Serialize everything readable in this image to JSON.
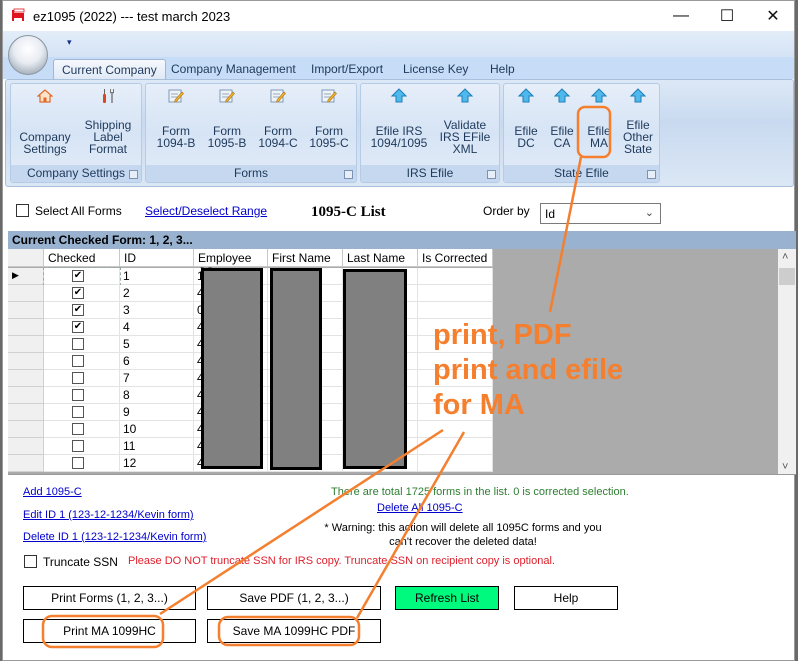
{
  "window": {
    "title": "ez1095 (2022) --- test march 2023",
    "minimize_glyph": "—",
    "maximize_glyph": "☐",
    "close_glyph": "✕"
  },
  "ribbon": {
    "qat_glyph": "▾",
    "tabs": [
      {
        "label": "Current Company",
        "active": true
      },
      {
        "label": "Company Management",
        "active": false
      },
      {
        "label": "Import/Export",
        "active": false
      },
      {
        "label": "License Key",
        "active": false
      },
      {
        "label": "Help",
        "active": false
      }
    ],
    "groups": [
      {
        "label": "Company Settings",
        "buttons": [
          {
            "label": "Company Settings",
            "icon": "home-icon"
          },
          {
            "label": "Shipping Label Format",
            "icon": "tools-icon"
          }
        ]
      },
      {
        "label": "Forms",
        "buttons": [
          {
            "label": "Form 1094-B",
            "icon": "form-edit-icon"
          },
          {
            "label": "Form 1095-B",
            "icon": "form-edit-icon"
          },
          {
            "label": "Form 1094-C",
            "icon": "form-edit-icon"
          },
          {
            "label": "Form 1095-C",
            "icon": "form-edit-icon"
          }
        ]
      },
      {
        "label": "IRS Efile",
        "buttons": [
          {
            "label": "Efile IRS 1094/1095",
            "icon": "upload-arrow-icon"
          },
          {
            "label": "Validate IRS EFile XML",
            "icon": "upload-arrow-icon"
          }
        ]
      },
      {
        "label": "State Efile",
        "buttons": [
          {
            "label": "Efile DC",
            "icon": "upload-arrow-icon"
          },
          {
            "label": "Efile CA",
            "icon": "upload-arrow-icon"
          },
          {
            "label": "Efile MA",
            "icon": "upload-arrow-icon"
          },
          {
            "label": "Efile Other State",
            "icon": "upload-arrow-icon"
          }
        ]
      }
    ]
  },
  "list_toolbar": {
    "select_all_label": "Select All Forms",
    "select_range_link": "Select/Deselect Range",
    "list_title": "1095-C List",
    "order_by_label": "Order by",
    "order_by_value": "Id"
  },
  "grid": {
    "checked_banner": "Current Checked Form: 1, 2, 3...",
    "columns": [
      "Checked",
      "ID",
      "Employee SS",
      "First Name",
      "Last Name",
      "Is Corrected"
    ],
    "rows": [
      {
        "checked": true,
        "id": "1",
        "ssn_first": "1"
      },
      {
        "checked": true,
        "id": "2",
        "ssn_first": "4"
      },
      {
        "checked": true,
        "id": "3",
        "ssn_first": "0"
      },
      {
        "checked": true,
        "id": "4",
        "ssn_first": "4"
      },
      {
        "checked": false,
        "id": "5",
        "ssn_first": "4"
      },
      {
        "checked": false,
        "id": "6",
        "ssn_first": "4"
      },
      {
        "checked": false,
        "id": "7",
        "ssn_first": "4"
      },
      {
        "checked": false,
        "id": "8",
        "ssn_first": "4"
      },
      {
        "checked": false,
        "id": "9",
        "ssn_first": "4"
      },
      {
        "checked": false,
        "id": "10",
        "ssn_first": "4"
      },
      {
        "checked": false,
        "id": "11",
        "ssn_first": "4"
      },
      {
        "checked": false,
        "id": "12",
        "ssn_first": "4"
      }
    ],
    "current_row_glyph": "▶",
    "scroll_up": "˄",
    "scroll_down": "˅"
  },
  "actions": {
    "add_link": "Add 1095-C",
    "edit_link": "Edit ID 1 (123-12-1234/Kevin form)",
    "delete_link": "Delete ID 1 (123-12-1234/Kevin form)",
    "total_info": "There are total 1725 forms in the list. 0 is corrected selection.",
    "delete_all_link": "Delete All 1095-C",
    "warning_line1": "* Warning: this action will delete all 1095C forms and you",
    "warning_line2": "can't recover the deleted data!",
    "truncate_label": "Truncate SSN",
    "truncate_note": "Please DO NOT truncate SSN for IRS copy. Truncate SSN on recipient copy is optional.",
    "buttons": {
      "print_forms": "Print Forms (1, 2, 3...)",
      "save_pdf": "Save PDF (1, 2, 3...)",
      "refresh": "Refresh List",
      "help": "Help",
      "print_ma": "Print MA 1099HC",
      "save_ma_pdf": "Save MA 1099HC PDF"
    }
  },
  "annotation": {
    "line1": "print, PDF",
    "line2": "print and efile",
    "line3": "for MA",
    "color": "#f47f2f"
  }
}
